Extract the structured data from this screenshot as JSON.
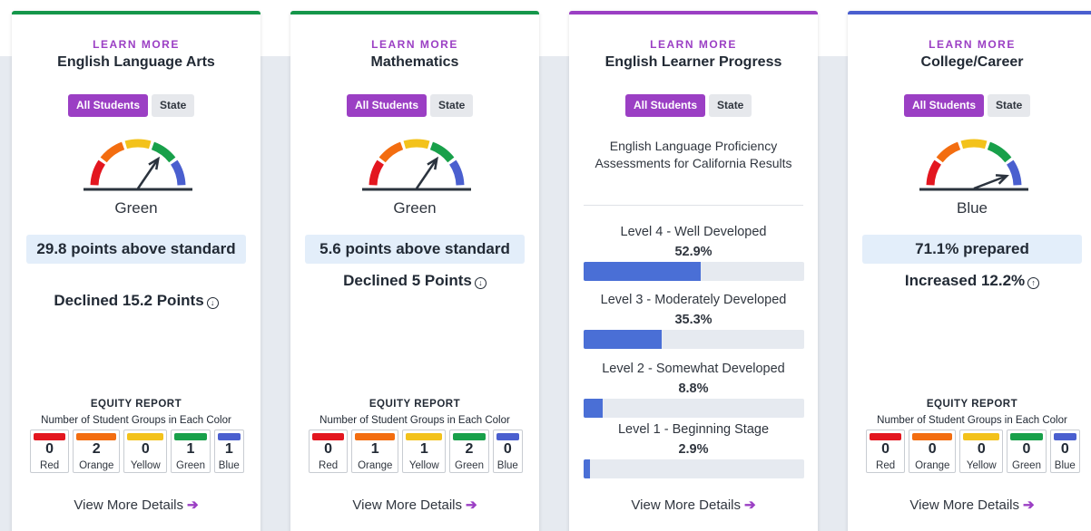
{
  "colors": {
    "purple": "#9b3fc4",
    "green": "#14964a",
    "blue": "#4a5fcf",
    "red": "#e3161f",
    "orange": "#f36d10",
    "yellow": "#f3c21b",
    "gauge_green": "#18a04a",
    "level_bar": "#4a6fd6"
  },
  "cards": [
    {
      "learn_more": "LEARN MORE",
      "title": "English Language Arts",
      "accent": "#14964a",
      "toggle": {
        "active": "All Students",
        "inactive": "State"
      },
      "gauge_level": 4,
      "color_label": "Green",
      "status": "29.8 points above standard",
      "change": "Declined 15.2 Points",
      "equity": {
        "title": "EQUITY REPORT",
        "subtitle": "Number of Student Groups in Each Color",
        "counts": [
          {
            "count": "0",
            "label": "Red",
            "color": "#e3161f"
          },
          {
            "count": "2",
            "label": "Orange",
            "color": "#f36d10"
          },
          {
            "count": "0",
            "label": "Yellow",
            "color": "#f3c21b"
          },
          {
            "count": "1",
            "label": "Green",
            "color": "#18a04a"
          },
          {
            "count": "1",
            "label": "Blue",
            "color": "#4a5fcf"
          }
        ]
      },
      "view_more": "View More Details"
    },
    {
      "learn_more": "LEARN MORE",
      "title": "Mathematics",
      "accent": "#14964a",
      "toggle": {
        "active": "All Students",
        "inactive": "State"
      },
      "gauge_level": 4,
      "color_label": "Green",
      "status": "5.6 points above standard",
      "change": "Declined 5 Points",
      "equity": {
        "title": "EQUITY REPORT",
        "subtitle": "Number of Student Groups in Each Color",
        "counts": [
          {
            "count": "0",
            "label": "Red",
            "color": "#e3161f"
          },
          {
            "count": "1",
            "label": "Orange",
            "color": "#f36d10"
          },
          {
            "count": "1",
            "label": "Yellow",
            "color": "#f3c21b"
          },
          {
            "count": "2",
            "label": "Green",
            "color": "#18a04a"
          },
          {
            "count": "0",
            "label": "Blue",
            "color": "#4a5fcf"
          }
        ]
      },
      "view_more": "View More Details"
    },
    {
      "learn_more": "LEARN MORE",
      "title": "English Learner Progress",
      "accent": "#9b3fc4",
      "toggle": {
        "active": "All Students",
        "inactive": "State"
      },
      "description": "English Language Proficiency Assessments for California Results",
      "levels": [
        {
          "label": "Level 4 - Well Developed",
          "pct": "52.9%",
          "value": 52.9
        },
        {
          "label": "Level 3 - Moderately Developed",
          "pct": "35.3%",
          "value": 35.3
        },
        {
          "label": "Level 2 - Somewhat Developed",
          "pct": "8.8%",
          "value": 8.8
        },
        {
          "label": "Level 1 - Beginning Stage",
          "pct": "2.9%",
          "value": 2.9
        }
      ],
      "view_more": "View More Details"
    },
    {
      "learn_more": "LEARN MORE",
      "title": "College/Career",
      "accent": "#4a5fcf",
      "toggle": {
        "active": "All Students",
        "inactive": "State"
      },
      "gauge_level": 5,
      "color_label": "Blue",
      "status": "71.1% prepared",
      "change": "Increased 12.2%",
      "equity": {
        "title": "EQUITY REPORT",
        "subtitle": "Number of Student Groups in Each Color",
        "counts": [
          {
            "count": "0",
            "label": "Red",
            "color": "#e3161f"
          },
          {
            "count": "0",
            "label": "Orange",
            "color": "#f36d10"
          },
          {
            "count": "0",
            "label": "Yellow",
            "color": "#f3c21b"
          },
          {
            "count": "0",
            "label": "Green",
            "color": "#18a04a"
          },
          {
            "count": "0",
            "label": "Blue",
            "color": "#4a5fcf"
          }
        ]
      },
      "view_more": "View More Details"
    }
  ]
}
